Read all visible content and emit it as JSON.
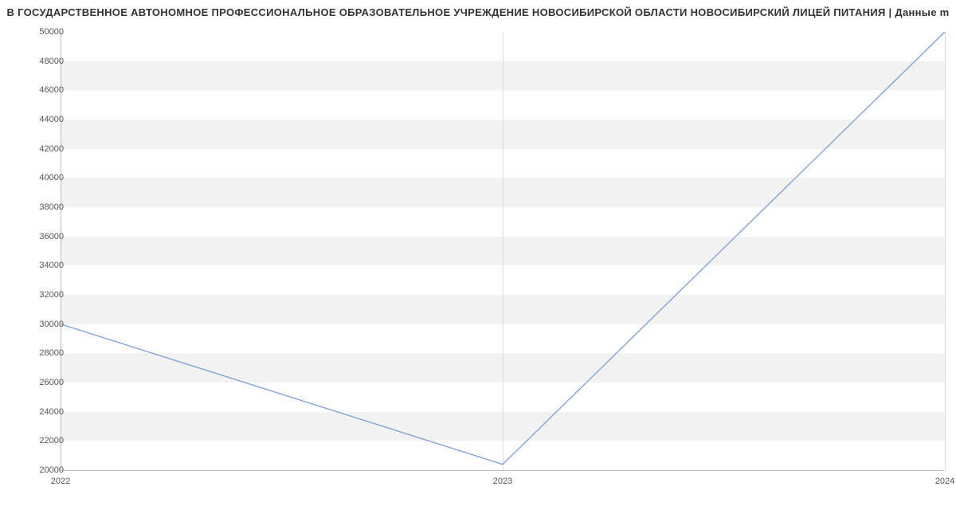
{
  "chart_data": {
    "type": "line",
    "title": "В ГОСУДАРСТВЕННОЕ АВТОНОМНОЕ ПРОФЕССИОНАЛЬНОЕ ОБРАЗОВАТЕЛЬНОЕ УЧРЕЖДЕНИЕ НОВОСИБИРСКОЙ ОБЛАСТИ НОВОСИБИРСКИЙ ЛИЦЕЙ ПИТАНИЯ | Данные m",
    "x": [
      2022,
      2023,
      2024
    ],
    "values": [
      30000,
      20400,
      50000
    ],
    "xlabel": "",
    "ylabel": "",
    "ylim": [
      20000,
      50000
    ],
    "y_ticks": [
      20000,
      22000,
      24000,
      26000,
      28000,
      30000,
      32000,
      34000,
      36000,
      38000,
      40000,
      42000,
      44000,
      46000,
      48000,
      50000
    ],
    "x_ticks": [
      2022,
      2023,
      2024
    ],
    "line_color": "#7a9edb"
  }
}
